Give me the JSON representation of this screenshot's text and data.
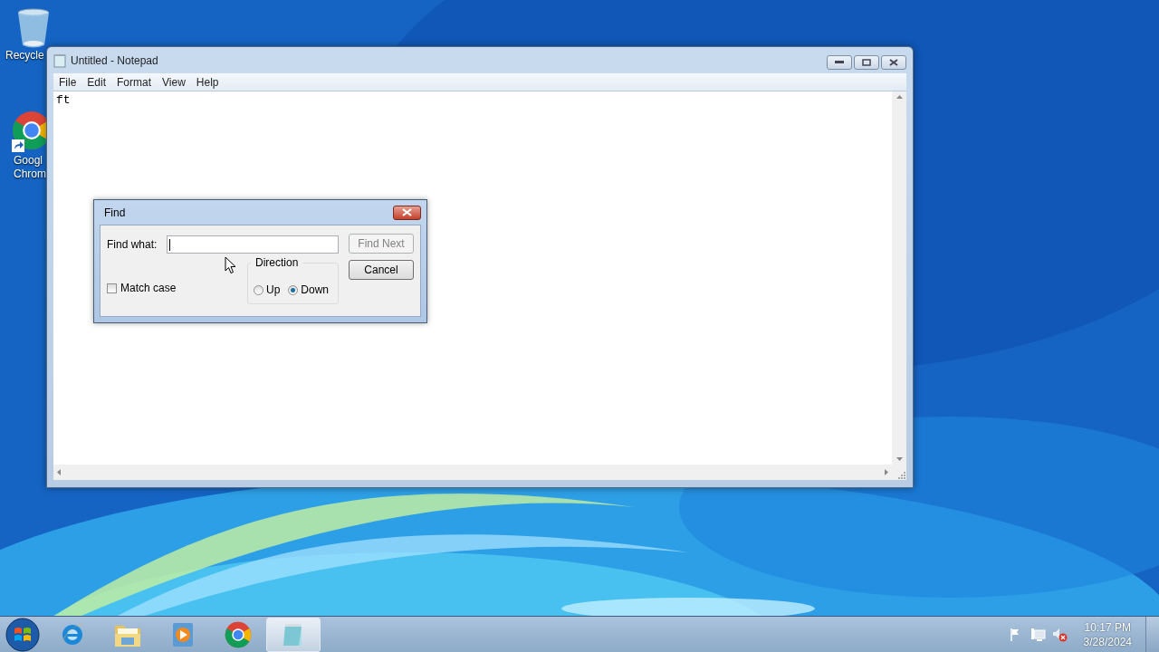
{
  "desktop_icons": [
    {
      "kind": "recycle",
      "lines": [
        "Recycle"
      ]
    },
    {
      "kind": "chrome",
      "lines": [
        "Googl",
        "Chrom"
      ]
    }
  ],
  "notepad": {
    "title": "Untitled - Notepad",
    "menu": [
      "File",
      "Edit",
      "Format",
      "View",
      "Help"
    ],
    "text": "ft"
  },
  "find_dialog": {
    "title": "Find",
    "find_what_label": "Find what:",
    "buttons": [
      {
        "label": "Find Next",
        "disabled": true
      },
      {
        "label": "Cancel",
        "disabled": false
      }
    ],
    "match_case": {
      "label": "Match case",
      "checked": false
    },
    "direction": {
      "label": "Direction",
      "options": [
        {
          "label": "Up",
          "selected": false
        },
        {
          "label": "Down",
          "selected": true
        }
      ]
    }
  },
  "taskbar": {
    "apps": [
      {
        "kind": "ie",
        "selected": false
      },
      {
        "kind": "explorer",
        "selected": false
      },
      {
        "kind": "media",
        "selected": false
      },
      {
        "kind": "chrome",
        "selected": false
      },
      {
        "kind": "notepad",
        "selected": true
      }
    ],
    "time": "10:17 PM",
    "date": "3/28/2024"
  }
}
